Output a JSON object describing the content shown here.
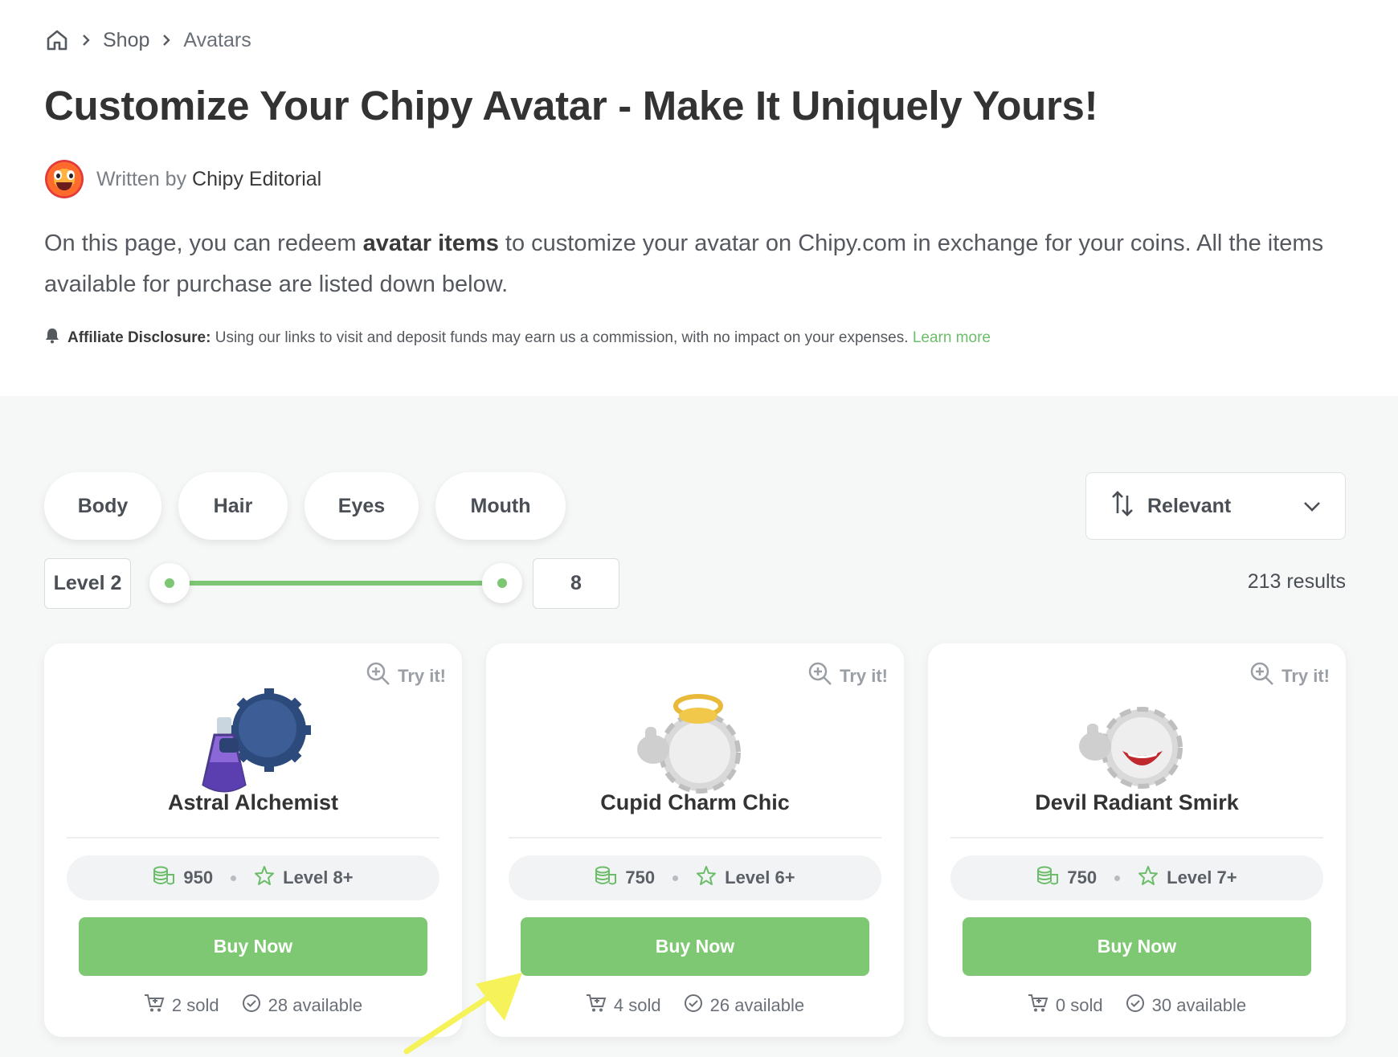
{
  "breadcrumb": {
    "home_icon": "home-icon",
    "items": [
      "Shop",
      "Avatars"
    ]
  },
  "page": {
    "title": "Customize Your Chipy Avatar - Make It Uniquely Yours!",
    "author_prefix": "Written by",
    "author_name": "Chipy Editorial",
    "intro_part1": "On this page, you can redeem ",
    "intro_bold": "avatar items",
    "intro_part2": " to customize your avatar on Chipy.com in exchange for your coins. All the items available for purchase are listed down below.",
    "disclosure_label": "Affiliate Disclosure:",
    "disclosure_text": "Using our links to visit and deposit funds may earn us a commission, with no impact on your expenses.",
    "disclosure_link": "Learn more"
  },
  "filters": {
    "categories": [
      "Body",
      "Hair",
      "Eyes",
      "Mouth"
    ],
    "sort_label": "Relevant",
    "level_min_label": "Level 2",
    "level_max_value": "8",
    "results": "213 results"
  },
  "cards": [
    {
      "try_label": "Try it!",
      "name": "Astral Alchemist",
      "price": "950",
      "level": "Level 8+",
      "buy_label": "Buy Now",
      "sold": "2 sold",
      "available": "28 available"
    },
    {
      "try_label": "Try it!",
      "name": "Cupid Charm Chic",
      "price": "750",
      "level": "Level 6+",
      "buy_label": "Buy Now",
      "sold": "4 sold",
      "available": "26 available"
    },
    {
      "try_label": "Try it!",
      "name": "Devil Radiant Smirk",
      "price": "750",
      "level": "Level 7+",
      "buy_label": "Buy Now",
      "sold": "0 sold",
      "available": "30 available"
    }
  ],
  "colors": {
    "accent_green": "#7fc873",
    "link_green": "#6cbd6a",
    "annotation_arrow": "#f5f25a"
  }
}
